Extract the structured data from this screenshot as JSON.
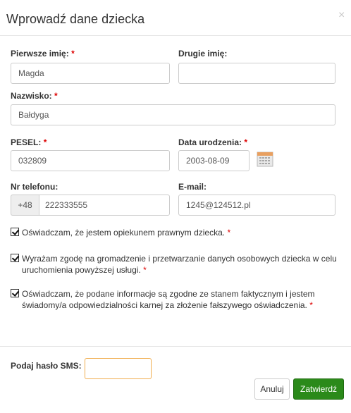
{
  "modal": {
    "title": "Wprowadź dane dziecka",
    "close": "×"
  },
  "form": {
    "first_name": {
      "label": "Pierwsze imię:",
      "required_mark": "*",
      "value": "Magda"
    },
    "second_name": {
      "label": "Drugie imię:",
      "value": ""
    },
    "surname": {
      "label": "Nazwisko:",
      "required_mark": "*",
      "value": "Bałdyga"
    },
    "pesel": {
      "label": "PESEL:",
      "required_mark": "*",
      "value": "032809"
    },
    "birth_date": {
      "label": "Data urodzenia:",
      "required_mark": "*",
      "value": "2003-08-09"
    },
    "phone": {
      "label": "Nr telefonu:",
      "prefix": "+48",
      "value": "222333555"
    },
    "email": {
      "label": "E-mail:",
      "value": "1245@124512.pl"
    }
  },
  "checks": [
    {
      "text": "Oświadczam, że jestem opiekunem prawnym dziecka.",
      "required_mark": "*",
      "checked": true
    },
    {
      "text": "Wyrażam zgodę na gromadzenie i przetwarzanie danych osobowych dziecka w celu uruchomienia powyższej usługi.",
      "required_mark": "*",
      "checked": true
    },
    {
      "text": "Oświadczam, że podane informacje są zgodne ze stanem faktycznym i jestem świadomy/a odpowiedzialności karnej za złożenie fałszywego oświadczenia.",
      "required_mark": "*",
      "checked": true
    }
  ],
  "footer": {
    "sms_label": "Podaj hasło SMS:",
    "cancel_label": "Anuluj",
    "submit_label": "Zatwierdź"
  },
  "colors": {
    "required": "#dd0000",
    "submit": "#2b8a1a",
    "sms_focus_border": "#f0ad4e"
  },
  "icons": {
    "calendar": "calendar-icon",
    "close": "close-icon"
  }
}
